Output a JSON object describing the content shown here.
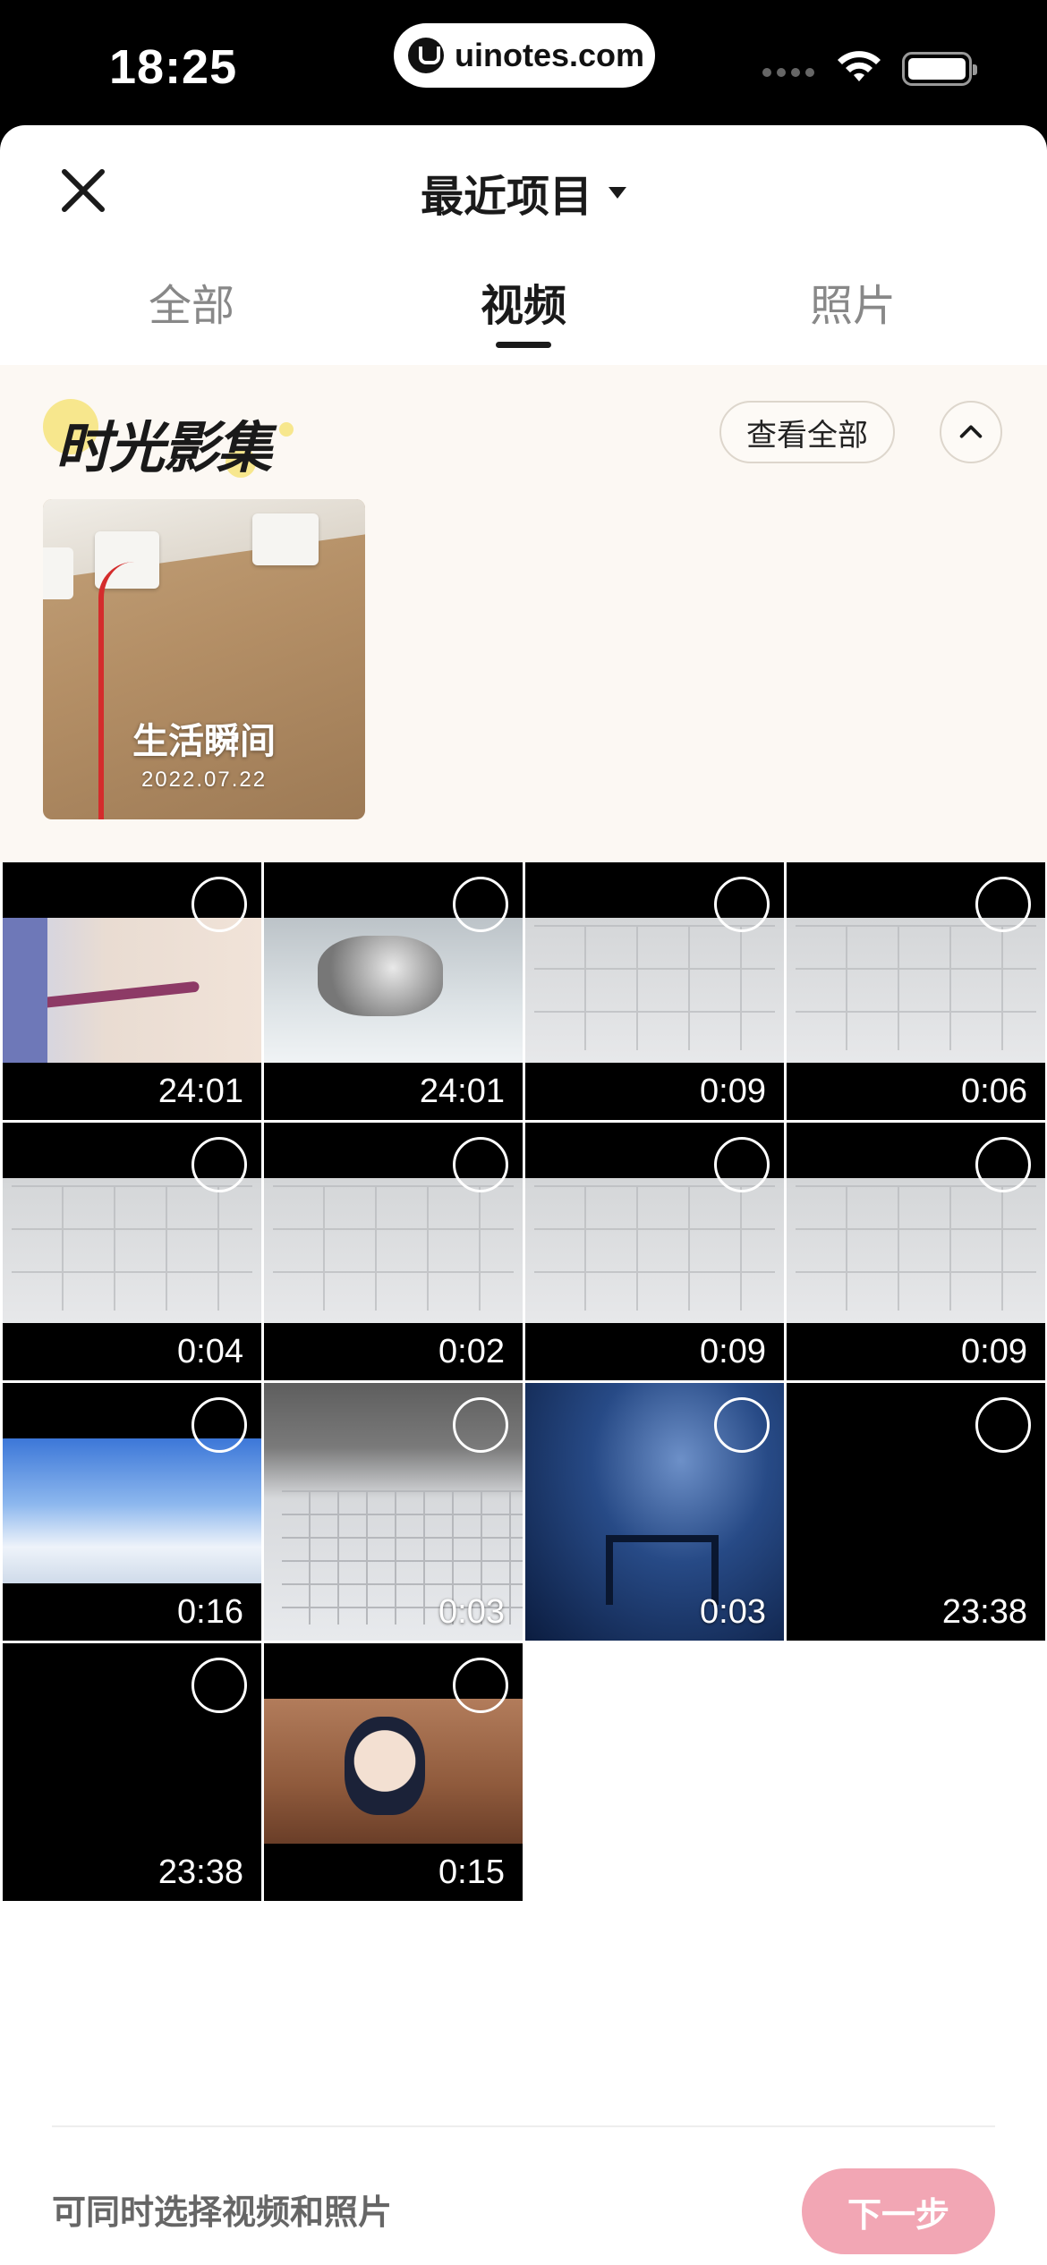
{
  "status_bar": {
    "time": "18:25",
    "url": "uinotes.com",
    "icons": [
      "signal-icon",
      "wifi-icon",
      "battery-icon"
    ]
  },
  "header": {
    "close_icon": "close-icon",
    "title": "最近项目",
    "title_caret_icon": "caret-down-icon"
  },
  "tabs": [
    {
      "label": "全部",
      "active": false
    },
    {
      "label": "视频",
      "active": true
    },
    {
      "label": "照片",
      "active": false
    }
  ],
  "memories": {
    "title": "时光影集",
    "view_all_label": "查看全部",
    "collapse_icon": "chevron-up-icon",
    "album": {
      "name": "生活瞬间",
      "date": "2022.07.22"
    }
  },
  "videos": [
    {
      "duration": "24:01",
      "thumb": "anime1"
    },
    {
      "duration": "24:01",
      "thumb": "mech"
    },
    {
      "duration": "0:09",
      "thumb": "keys"
    },
    {
      "duration": "0:06",
      "thumb": "keys"
    },
    {
      "duration": "0:04",
      "thumb": "keys"
    },
    {
      "duration": "0:02",
      "thumb": "keys"
    },
    {
      "duration": "0:09",
      "thumb": "keys"
    },
    {
      "duration": "0:09",
      "thumb": "keys"
    },
    {
      "duration": "0:16",
      "thumb": "sky"
    },
    {
      "duration": "0:03",
      "thumb": "desk"
    },
    {
      "duration": "0:03",
      "thumb": "star"
    },
    {
      "duration": "23:38",
      "thumb": "black"
    },
    {
      "duration": "23:38",
      "thumb": "black"
    },
    {
      "duration": "0:15",
      "thumb": "girl"
    }
  ],
  "footer": {
    "hint": "可同时选择视频和照片",
    "next_label": "下一步"
  },
  "colors": {
    "accent_disabled": "#f2a6b4",
    "memories_bg": "#fcf8f3"
  }
}
